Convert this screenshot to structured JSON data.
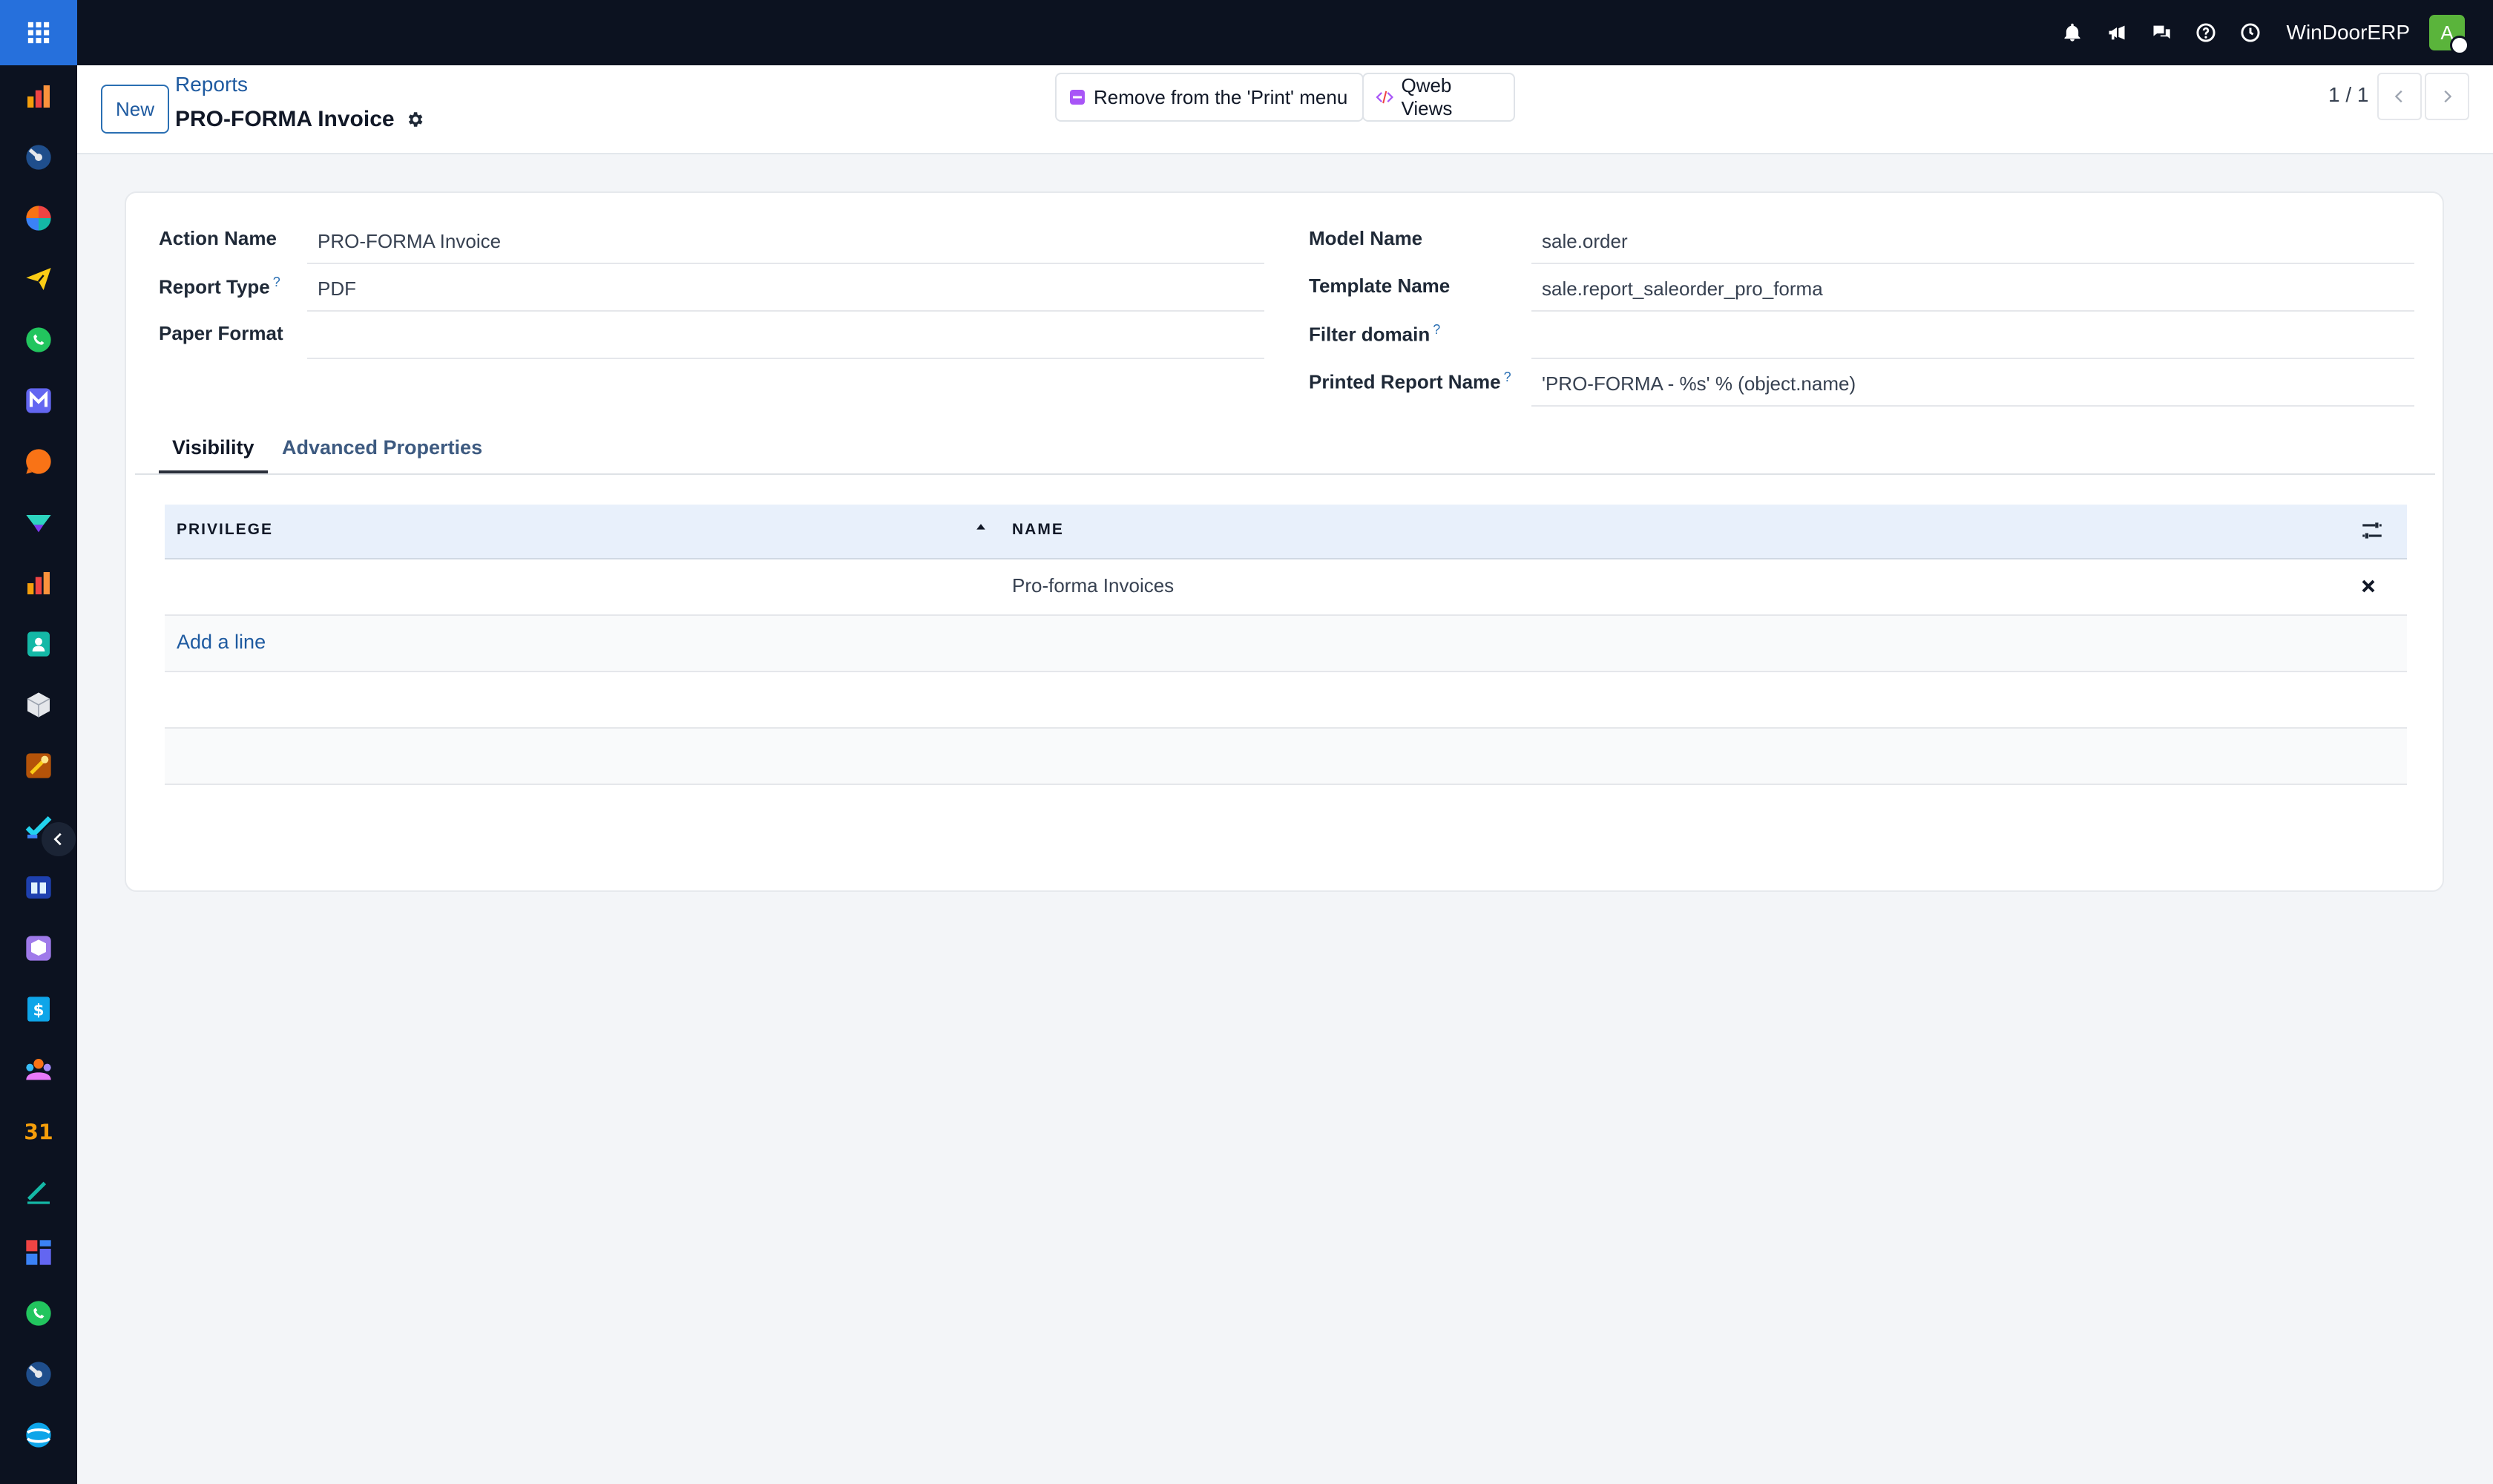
{
  "navbar": {
    "apps_icon": "grid-icon",
    "icons": [
      "bell-icon",
      "megaphone-icon",
      "chat-icon",
      "help-icon",
      "clock-icon"
    ],
    "company": "WinDoorERP",
    "avatar_initial": "A",
    "brand_color": "#2670dc"
  },
  "sidebar": {
    "apps": [
      "sales-app-icon",
      "dashboard-app-icon",
      "pie-app-icon",
      "send-app-icon",
      "whatsapp-app-icon",
      "mail-app-icon",
      "chat-app-icon",
      "discuss-app-icon",
      "reports-app-icon",
      "contacts-app-icon",
      "inventory-app-icon",
      "tools-app-icon",
      "project-app-icon",
      "knowledge-app-icon",
      "packages-app-icon",
      "invoicing-app-icon",
      "employees-app-icon",
      "calendar-app-icon",
      "sign-app-icon",
      "dashboard2-app-icon",
      "whatsapp2-app-icon",
      "dashboard3-app-icon",
      "website-app-icon"
    ],
    "calendar_day": "31"
  },
  "control": {
    "new_label": "New",
    "breadcrumb": "Reports",
    "title": "PRO-FORMA Invoice",
    "remove_print_label": "Remove from the 'Print' menu",
    "qweb_label": "Qweb Views",
    "pager": "1 / 1"
  },
  "form": {
    "left": [
      {
        "label": "Action Name",
        "help": "",
        "value": "PRO-FORMA Invoice"
      },
      {
        "label": "Report Type",
        "help": "?",
        "value": "PDF"
      },
      {
        "label": "Paper Format",
        "help": "",
        "value": ""
      }
    ],
    "right": [
      {
        "label": "Model Name",
        "help": "",
        "value": "sale.order"
      },
      {
        "label": "Template Name",
        "help": "",
        "value": "sale.report_saleorder_pro_forma"
      },
      {
        "label": "Filter domain",
        "help": "?",
        "value": ""
      },
      {
        "label": "Printed Report Name",
        "help": "?",
        "value": "'PRO-FORMA - %s' % (object.name)"
      }
    ]
  },
  "tabs": [
    "Visibility",
    "Advanced Properties"
  ],
  "table": {
    "columns": [
      "PRIVILEGE",
      "NAME"
    ],
    "rows": [
      {
        "privilege": "",
        "name": "Pro-forma Invoices"
      }
    ],
    "add_line": "Add a line"
  }
}
